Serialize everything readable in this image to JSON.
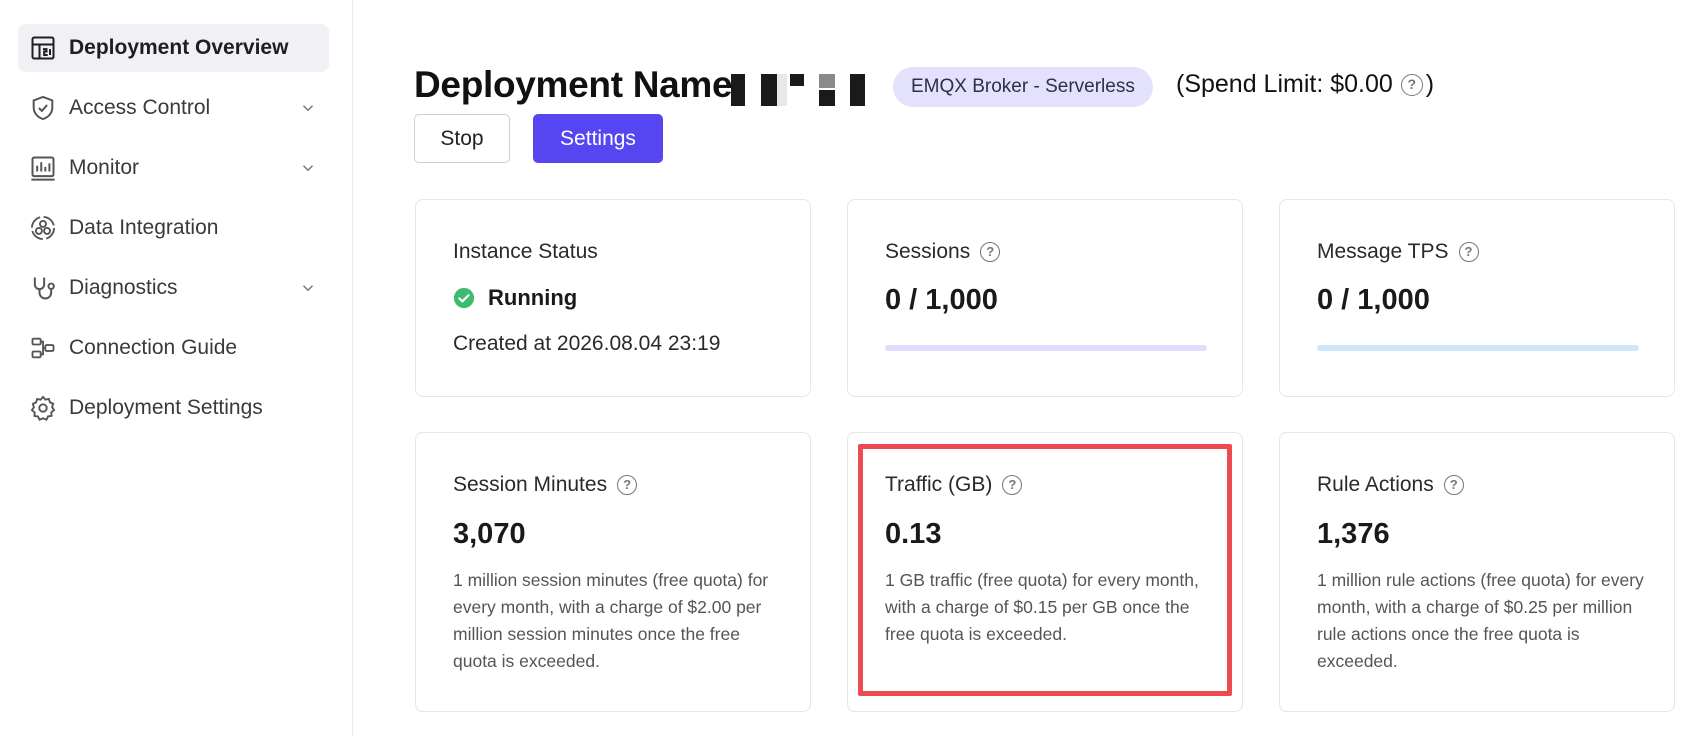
{
  "sidebar": {
    "items": [
      {
        "label": "Deployment Overview"
      },
      {
        "label": "Access Control"
      },
      {
        "label": "Monitor"
      },
      {
        "label": "Data Integration"
      },
      {
        "label": "Diagnostics"
      },
      {
        "label": "Connection Guide"
      },
      {
        "label": "Deployment Settings"
      }
    ]
  },
  "header": {
    "title": "Deployment Name:",
    "badge": "EMQX Broker - Serverless",
    "spend_prefix": "(Spend Limit: $0.00",
    "spend_suffix": ")",
    "stop_label": "Stop",
    "settings_label": "Settings"
  },
  "cards": {
    "instance": {
      "label": "Instance Status",
      "status": "Running",
      "created": "Created at 2026.08.04 23:19"
    },
    "sessions": {
      "label": "Sessions",
      "value": "0 / 1,000",
      "progress": 0
    },
    "tps": {
      "label": "Message TPS",
      "value": "0 / 1,000",
      "progress": 0
    },
    "session_minutes": {
      "label": "Session Minutes",
      "value": "3,070",
      "desc": "1 million session minutes (free quota) for every month, with a charge of $2.00 per million session minutes once the free quota is exceeded."
    },
    "traffic": {
      "label": "Traffic (GB)",
      "value": "0.13",
      "desc": "1 GB traffic (free quota) for every month, with a charge of $0.15 per GB once the free quota is exceeded."
    },
    "rule_actions": {
      "label": "Rule Actions",
      "value": "1,376",
      "desc": "1 million rule actions (free quota) for every month, with a charge of $0.25 per million rule actions once the free quota is exceeded."
    }
  },
  "colors": {
    "accent": "#5546f2",
    "badge_bg": "#e3e1fb",
    "running": "#3dbb6e",
    "highlight": "#ec4b51"
  }
}
